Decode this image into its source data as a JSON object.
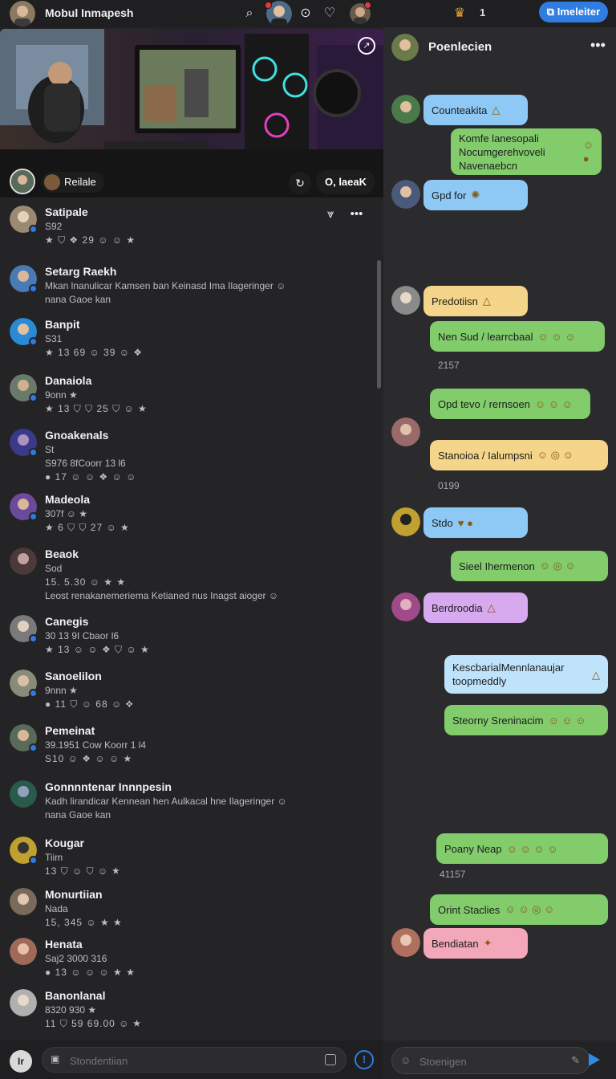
{
  "topbar": {
    "title": "Mobul Inmapesh",
    "count": "1",
    "button_label": "Imeleiter"
  },
  "hero": {
    "chip_label": "Reilale",
    "pill_label": "O, laeaK"
  },
  "list": [
    {
      "name": "Satipale",
      "l2": "S92",
      "l3": "★ ⛉ ❖ 29 ☺ ☺ ★",
      "l4": ""
    },
    {
      "name": "Setarg Raekh",
      "l2": "Mkan lnanulicar Kamsen ban Keinasd Ima Ilageringer ☺",
      "l3": "nana Gaoe kan",
      "l4": ""
    },
    {
      "name": "Banpit",
      "l2": "S31",
      "l3": "★ 13 69 ☺ 39 ☺ ❖",
      "l4": ""
    },
    {
      "name": "Danaiola",
      "l2": "9onn ★",
      "l3": "★ 13 ⛉ ⛉ 25 ⛉ ☺ ★",
      "l4": ""
    },
    {
      "name": "Gnoakenals",
      "l2": "St",
      "l3": "S976 8fCoorr 13 l6",
      "l4": "● 17 ☺ ☺ ❖ ☺ ☺"
    },
    {
      "name": "Madeola",
      "l2": "307f ☺ ★",
      "l3": "★ 6 ⛉ ⛉ 27 ☺ ★",
      "l4": ""
    },
    {
      "name": "Beaok",
      "l2": "Sod",
      "l3": "15. 5.30 ☺ ★ ★",
      "l4": "Leost renakanemeriema Ketianed nus Inagst aioger ☺"
    },
    {
      "name": "Canegis",
      "l2": "30 13 9I Cbaor l6",
      "l3": "★ 13 ☺ ☺ ❖ ⛉ ☺ ★",
      "l4": ""
    },
    {
      "name": "Sanoelilon",
      "l2": "9nnn ★",
      "l3": "● 11 ⛉ ☺ 68 ☺ ❖",
      "l4": ""
    },
    {
      "name": "Pemeinat",
      "l2": "39.1951 Cow Koorr 1 l4",
      "l3": "S10 ☺ ❖ ☺ ☺ ★",
      "l4": ""
    },
    {
      "name": "Gonnnntenar Innnpesin",
      "l2": "Kadh lirandicar Kennean hen Aulkacal hne Ilageringer ☺",
      "l3": "nana Gaoe kan",
      "l4": ""
    },
    {
      "name": "Kougar",
      "l2": "Tiim",
      "l3": "13 ⛉ ☺ ⛉ ☺ ★",
      "l4": ""
    },
    {
      "name": "Monurtiian",
      "l2": "Nada",
      "l3": "15, 345 ☺ ★ ★",
      "l4": ""
    },
    {
      "name": "Henata",
      "l2": "Saj2 3000 316",
      "l3": "● 13 ☺ ☺ ☺ ★ ★",
      "l4": ""
    },
    {
      "name": "Banonlanal",
      "l2": "8320 930 ★",
      "l3": "11 ⛉ 59 69.00 ☺ ★",
      "l4": ""
    }
  ],
  "composer_left": {
    "placeholder": "Stondentiian"
  },
  "right": {
    "title": "Poenlecien",
    "messages": [
      {
        "text": "Counteakita",
        "emoji": "△"
      },
      {
        "text": "Komfe lanesopali Nocumgerehvoveli Navenaebcn",
        "emoji": "☺ ●"
      },
      {
        "text": "Gpd for",
        "emoji": "✺"
      },
      {
        "text": "Predotiisn",
        "emoji": "△"
      },
      {
        "text": "Nen Sud / learrcbaal",
        "emoji": "☺ ☺ ☺"
      },
      {
        "text": "Opd tevo / rernsoen",
        "emoji": "☺ ☺ ☺"
      },
      {
        "text": "Stanoioa / Ialumpsni",
        "emoji": "☺ ◎ ☺"
      },
      {
        "text": "Stdo",
        "emoji": "♥ ●"
      },
      {
        "text": "Sieel Ihermenon",
        "emoji": "☺ ◎ ☺"
      },
      {
        "text": "Berdroodia",
        "emoji": "△"
      },
      {
        "text": "KescbarialMennlanaujar toopmeddly",
        "emoji": "△"
      },
      {
        "text": "Steorny Sreninacim",
        "emoji": "☺ ☺ ☺"
      },
      {
        "text": "Poany Neap",
        "emoji": "☺ ☺ ☺ ☺"
      },
      {
        "text": "Orint Staclies",
        "emoji": "☺ ☺ ◎ ☺"
      },
      {
        "text": "Bendiatan",
        "emoji": "✦"
      }
    ],
    "times": [
      "2157",
      "0199",
      "41157"
    ],
    "composer_placeholder": "Stoenigen"
  }
}
